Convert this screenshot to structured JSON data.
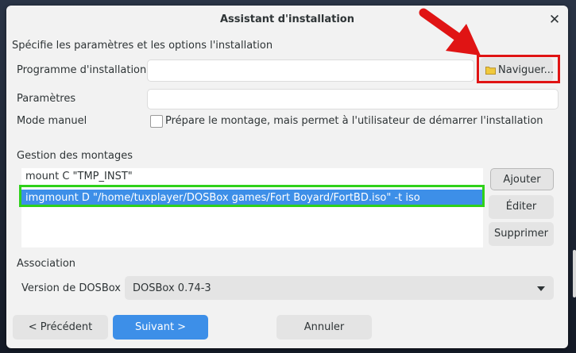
{
  "window": {
    "title": "Assistant d'installation",
    "close_glyph": "✕"
  },
  "subtitle": "Spécifie les paramètres et les options l'installation",
  "form": {
    "installer_label": "Programme d'installation",
    "installer_value": "",
    "browse_icon": "folder-icon",
    "browse_label": "Naviguer...",
    "params_label": "Paramètres",
    "params_value": "",
    "manual_label": "Mode manuel",
    "manual_checked": false,
    "manual_checkbox_text": "Prépare le montage, mais permet à l'utilisateur de démarrer l'installation"
  },
  "mounts": {
    "section_label": "Gestion des montages",
    "items": [
      "mount C \"TMP_INST\"",
      "imgmount D \"/home/tuxplayer/DOSBox games/Fort Boyard/FortBD.iso\" -t iso"
    ],
    "selected_index": 1,
    "add_label": "Ajouter",
    "edit_label": "Éditer",
    "remove_label": "Supprimer"
  },
  "association": {
    "section_label": "Association",
    "version_label": "Version de DOSBox",
    "version_value": "DOSBox 0.74-3"
  },
  "footer": {
    "prev_label": "< Précédent",
    "next_label": "Suivant >",
    "cancel_label": "Annuler"
  },
  "colors": {
    "accent": "#3d8fe8",
    "highlight_green": "#2fd11a",
    "highlight_red": "#e01414"
  }
}
